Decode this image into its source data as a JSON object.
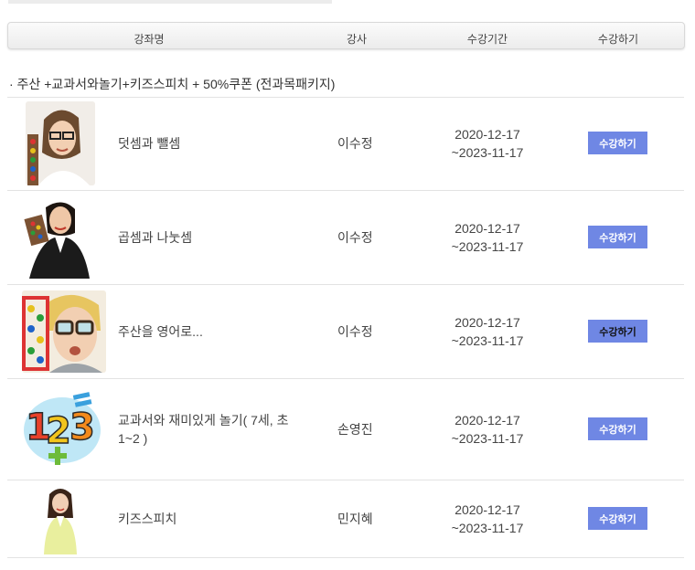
{
  "table_header": {
    "course": "강좌명",
    "teacher": "강사",
    "period": "수강기간",
    "action": "수강하기"
  },
  "group_title": "· 주산 +교과서와놀기+키즈스피치 + 50%쿠폰 (전과목패키지)",
  "courses": [
    {
      "name": "덧셈과 뺄셈",
      "teacher": "이수정",
      "start": "2020-12-17",
      "end": "~2023-11-17",
      "button": "수강하기",
      "thumb_icon": "teacher-with-abacus-photo"
    },
    {
      "name": "곱셈과 나눗셈",
      "teacher": "이수정",
      "start": "2020-12-17",
      "end": "~2023-11-17",
      "button": "수강하기",
      "thumb_icon": "woman-holding-abacus-photo"
    },
    {
      "name": "주산을 영어로...",
      "teacher": "이수정",
      "start": "2020-12-17",
      "end": "~2023-11-17",
      "button": "수강하기",
      "thumb_icon": "child-with-glasses-abacus-photo"
    },
    {
      "name": "교과서와 재미있게 놀기( 7세, 초1~2 )",
      "teacher": "손영진",
      "start": "2020-12-17",
      "end": "~2023-11-17",
      "button": "수강하기",
      "thumb_icon": "numbers-123-illustration"
    },
    {
      "name": "키즈스피치",
      "teacher": "민지혜",
      "start": "2020-12-17",
      "end": "~2023-11-17",
      "button": "수강하기",
      "thumb_icon": "woman-speaker-photo"
    }
  ]
}
